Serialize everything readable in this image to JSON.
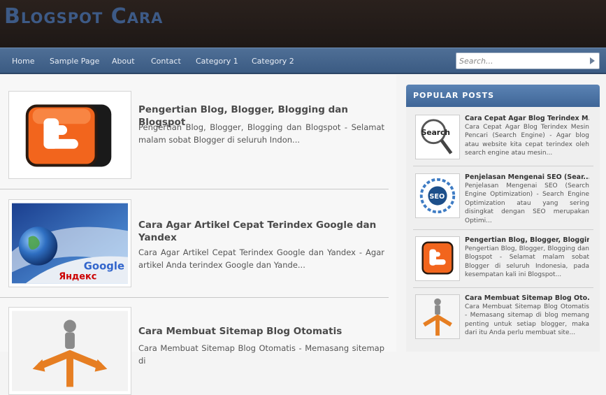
{
  "header": {
    "site_title": "Blogspot Cara"
  },
  "nav": {
    "items": [
      {
        "label": "Home"
      },
      {
        "label": "Sample Page"
      },
      {
        "label": "About"
      },
      {
        "label": "Contact"
      },
      {
        "label": "Category 1"
      },
      {
        "label": "Category 2"
      }
    ]
  },
  "search": {
    "placeholder": "Search...",
    "icon": "arrow-right-icon"
  },
  "posts": [
    {
      "title": "Pengertian Blog, Blogger, Blogging dan Blogspot",
      "excerpt": "Pengertian Blog, Blogger, Blogging dan Blogspot  - Selamat malam sobat Blogger di seluruh Indon...",
      "thumb": "blogger-logo"
    },
    {
      "title": "Cara Agar Artikel Cepat Terindex Google dan Yandex",
      "excerpt": "Cara Agar Artikel Cepat Terindex Google dan Yandex  - Agar artikel Anda terindex Google dan Yande...",
      "thumb_text": {
        "google": "Google",
        "yandex": "Яндекс"
      }
    },
    {
      "title": "Cara Membuat Sitemap Blog Otomatis",
      "excerpt": "Cara Membuat Sitemap Blog Otomatis  - Memasang sitemap di",
      "thumb": "person-with-arrows"
    }
  ],
  "sidebar": {
    "heading": "POPULAR POSTS",
    "items": [
      {
        "title": "Cara Cepat Agar Blog Terindex M...",
        "snippet": "Cara Cepat Agar Blog Terindex Mesin Pencari (Search Engine)  - Agar blog atau website kita cepat terindex oleh search engine  atau mesin...",
        "thumb_text": "Search"
      },
      {
        "title": "Penjelasan Mengenai SEO (Sear...",
        "snippet": "Penjelasan Mengenai SEO (Search Engine Optimization)  - Search Engine Optimization atau yang sering disingkat dengan SEO merupakan Optimi...",
        "thumb_text": "SEO"
      },
      {
        "title": "Pengertian Blog, Blogger, Bloggin...",
        "snippet": "Pengertian Blog, Blogger, Blogging dan Blogspot  - Selamat malam sobat Blogger di seluruh Indonesia, pada kesempatan kali ini  Blogspot...",
        "thumb": "blogger-logo"
      },
      {
        "title": "Cara Membuat Sitemap Blog Oto...",
        "snippet": "Cara Membuat Sitemap Blog Otomatis  - Memasang sitemap di blog memang penting untuk setiap blogger, maka dari itu Anda perlu membuat site...",
        "thumb": "person-with-arrows"
      }
    ]
  },
  "colors": {
    "header_bg": "#241c19",
    "nav_bg": "#46668e",
    "title": "#3d5a86",
    "sidebar_heading": "#4c74a6",
    "blogger_orange": "#f05a14"
  }
}
